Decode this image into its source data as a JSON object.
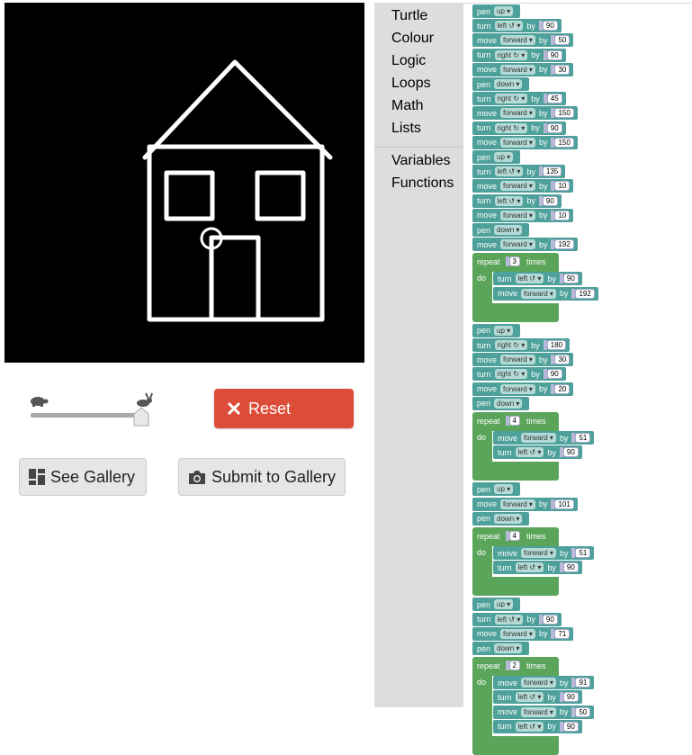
{
  "controls": {
    "reset_label": "Reset",
    "see_gallery_label": "See Gallery",
    "submit_label": "Submit to Gallery",
    "speed_value": 1.0
  },
  "toolbox": {
    "categories": [
      "Turtle",
      "Colour",
      "Logic",
      "Loops",
      "Math",
      "Lists"
    ],
    "custom": [
      "Variables",
      "Functions"
    ]
  },
  "program": [
    {
      "kw": "pen",
      "dd": "up"
    },
    {
      "kw": "turn",
      "dd": "left ↺",
      "by": "90"
    },
    {
      "kw": "move",
      "dd": "forward",
      "by": "50"
    },
    {
      "kw": "turn",
      "dd": "right ↻",
      "by": "90"
    },
    {
      "kw": "move",
      "dd": "forward",
      "by": "30"
    },
    {
      "kw": "pen",
      "dd": "down"
    },
    {
      "kw": "turn",
      "dd": "right ↻",
      "by": "45"
    },
    {
      "kw": "move",
      "dd": "forward",
      "by": "150"
    },
    {
      "kw": "turn",
      "dd": "right ↻",
      "by": "90"
    },
    {
      "kw": "move",
      "dd": "forward",
      "by": "150"
    },
    {
      "kw": "pen",
      "dd": "up"
    },
    {
      "kw": "turn",
      "dd": "left ↺",
      "by": "135"
    },
    {
      "kw": "move",
      "dd": "forward",
      "by": "10"
    },
    {
      "kw": "turn",
      "dd": "left ↺",
      "by": "90"
    },
    {
      "kw": "move",
      "dd": "forward",
      "by": "10"
    },
    {
      "kw": "pen",
      "dd": "down"
    },
    {
      "kw": "move",
      "dd": "forward",
      "by": "192"
    },
    {
      "repeat": "3",
      "body": [
        {
          "kw": "turn",
          "dd": "left ↺",
          "by": "90"
        },
        {
          "kw": "move",
          "dd": "forward",
          "by": "192"
        }
      ]
    },
    {
      "kw": "pen",
      "dd": "up"
    },
    {
      "kw": "turn",
      "dd": "right ↻",
      "by": "180"
    },
    {
      "kw": "move",
      "dd": "forward",
      "by": "30"
    },
    {
      "kw": "turn",
      "dd": "right ↻",
      "by": "90"
    },
    {
      "kw": "move",
      "dd": "forward",
      "by": "20"
    },
    {
      "kw": "pen",
      "dd": "down"
    },
    {
      "repeat": "4",
      "body": [
        {
          "kw": "move",
          "dd": "forward",
          "by": "51"
        },
        {
          "kw": "turn",
          "dd": "left ↺",
          "by": "90"
        }
      ]
    },
    {
      "kw": "pen",
      "dd": "up"
    },
    {
      "kw": "move",
      "dd": "forward",
      "by": "101"
    },
    {
      "kw": "pen",
      "dd": "down"
    },
    {
      "repeat": "4",
      "body": [
        {
          "kw": "move",
          "dd": "forward",
          "by": "51"
        },
        {
          "kw": "turn",
          "dd": "left ↺",
          "by": "90"
        }
      ]
    },
    {
      "kw": "pen",
      "dd": "up"
    },
    {
      "kw": "turn",
      "dd": "left ↺",
      "by": "90"
    },
    {
      "kw": "move",
      "dd": "forward",
      "by": "71"
    },
    {
      "kw": "pen",
      "dd": "down"
    },
    {
      "repeat": "2",
      "body": [
        {
          "kw": "move",
          "dd": "forward",
          "by": "91"
        },
        {
          "kw": "turn",
          "dd": "left ↺",
          "by": "90"
        },
        {
          "kw": "move",
          "dd": "forward",
          "by": "50"
        },
        {
          "kw": "turn",
          "dd": "left ↺",
          "by": "90"
        }
      ]
    }
  ],
  "labels": {
    "by": "by",
    "times": "times",
    "do": "do",
    "repeat": "repeat"
  }
}
